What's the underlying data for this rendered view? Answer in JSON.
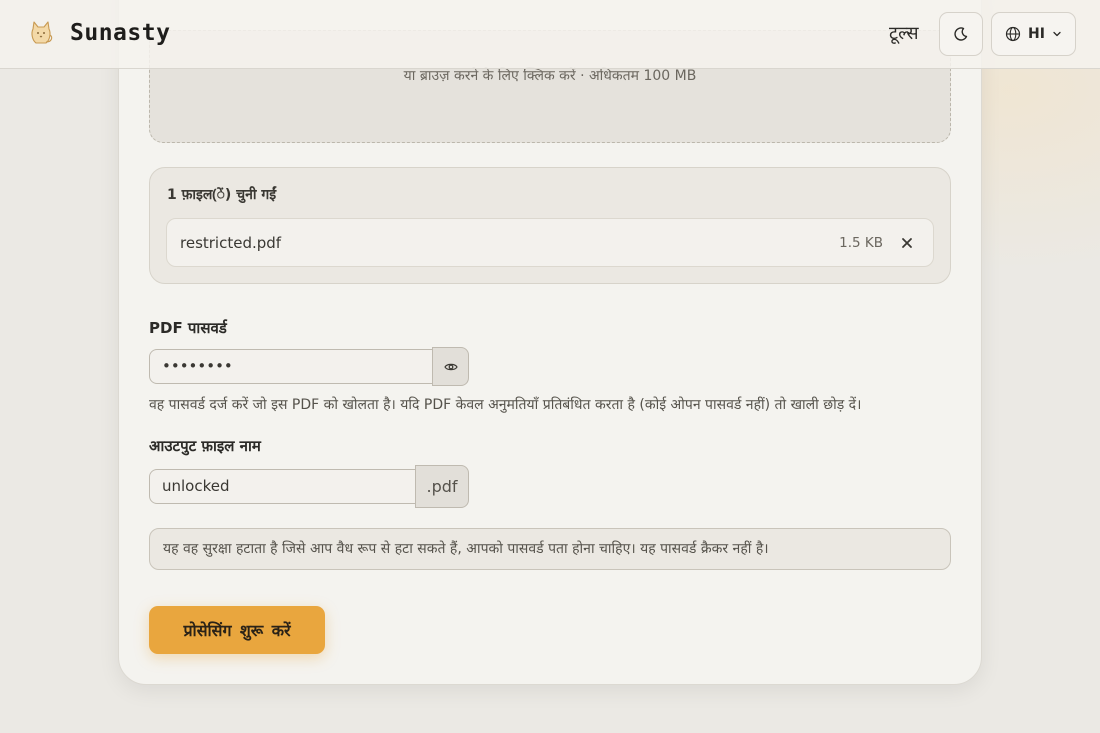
{
  "header": {
    "brand_name": "Sunasty",
    "logo_icon": "cat-logo-icon",
    "tools_label": "टूल्स",
    "theme_icon": "moon-icon",
    "language_icon": "globe-icon",
    "language_label": "HI",
    "language_chevron": "chevron-down-icon"
  },
  "dropzone": {
    "hint": "या ब्राउज़ करने के लिए क्लिक करें · अधिकतम 100 MB"
  },
  "files": {
    "count_label": "1 फ़ाइल(ें) चुनी गईं",
    "items": [
      {
        "name": "restricted.pdf",
        "size": "1.5 KB",
        "remove_icon": "close-icon"
      }
    ]
  },
  "password": {
    "label": "PDF पासवर्ड",
    "value": "••••••••",
    "toggle_icon": "eye-icon",
    "help": "वह पासवर्ड दर्ज करें जो इस PDF को खोलता है। यदि PDF केवल अनुमतियाँ प्रतिबंधित करता है (कोई ओपन पासवर्ड नहीं) तो खाली छोड़ दें।"
  },
  "output": {
    "label": "आउटपुट फ़ाइल नाम",
    "value": "unlocked",
    "extension": ".pdf"
  },
  "notice": "यह वह सुरक्षा हटाता है जिसे आप वैध रूप से हटा सकते हैं, आपको पासवर्ड पता होना चाहिए। यह पासवर्ड क्रैकर नहीं है।",
  "actions": {
    "start_label": "प्रोसेसिंग शुरू करें"
  },
  "colors": {
    "accent": "#e9a63e",
    "background": "#ebe9e4",
    "card": "#f4f3ef"
  }
}
